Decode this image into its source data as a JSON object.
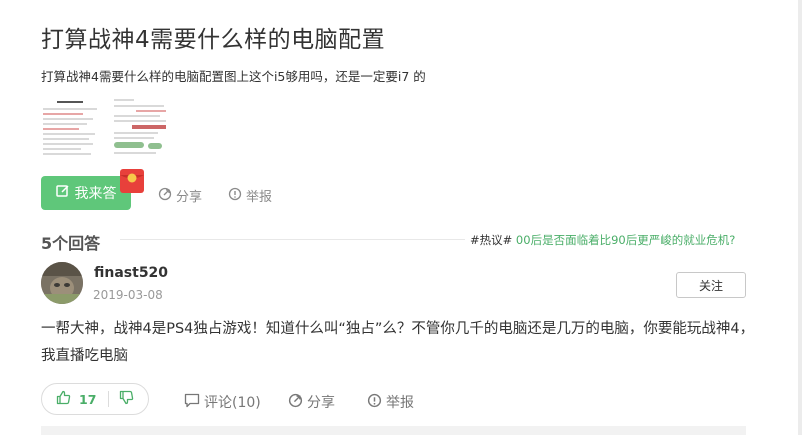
{
  "question": {
    "title": "打算战神4需要什么样的电脑配置",
    "description": "打算战神4需要什么样的电脑配置图上这个i5够用吗，还是一定要i7 的"
  },
  "actions": {
    "answer_label": "我来答",
    "share_label": "分享",
    "report_label": "举报"
  },
  "answers_section": {
    "count_label": "5个回答",
    "hot_topic_tag": "#热议#",
    "hot_topic_text": " 00后是否面临着比90后更严峻的就业危机?"
  },
  "answer": {
    "user_name": "finast520",
    "date": "2019-03-08",
    "follow_label": "关注",
    "body": "一帮大神，战神4是PS4独占游戏！知道什么叫“独占”么？不管你几千的电脑还是几万的电脑，你要能玩战神4，我直播吃电脑",
    "like_count": "17",
    "comment_label": "评论(10)",
    "share_label": "分享",
    "report_label": "举报"
  },
  "colors": {
    "accent_green": "#5fc77a",
    "link_green": "#4aae68",
    "muted_gray": "#8a8a8a"
  },
  "icons": [
    "edit-icon",
    "red-envelope-icon",
    "share-icon",
    "report-icon",
    "thumbs-up-icon",
    "thumbs-down-icon",
    "comment-icon"
  ]
}
